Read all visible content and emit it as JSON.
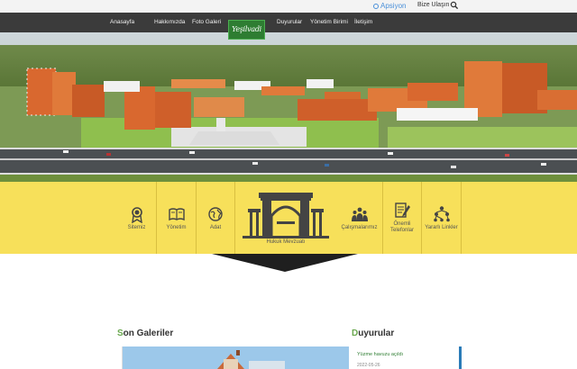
{
  "topbar": {
    "apsiyon_label": "Apsiyon",
    "contact_label": "Bize Ulaşın"
  },
  "nav": {
    "items": [
      "Anasayfa",
      "Hakkımızda",
      "Foto Galeri",
      "Duyurular",
      "Yönetim Birimi",
      "İletişim"
    ]
  },
  "logo": {
    "text": "Yeşilvadi"
  },
  "features": {
    "items": [
      {
        "label": "Sitemiz",
        "icon": "award-badge-icon"
      },
      {
        "label": "Yönetim",
        "icon": "book-icon"
      },
      {
        "label": "Adat",
        "icon": "globe-icon"
      },
      {
        "label": "Hukuk Mevzuatı",
        "icon": "arch-gate-icon"
      },
      {
        "label": "Çalışmalarımız",
        "icon": "team-icon"
      },
      {
        "label": "Önemli Telefonlar",
        "icon": "document-pen-icon"
      },
      {
        "label": "Yararlı Linkler",
        "icon": "network-icon"
      }
    ]
  },
  "sections": {
    "gallery_title_first": "S",
    "gallery_title_rest": "on Galeriler",
    "announcements_title_first": "D",
    "announcements_title_rest": "uyurular"
  },
  "announcement": {
    "title": "Yüzme havuzu açıldı",
    "date": "2022-05-26"
  },
  "colors": {
    "nav_bg": "#3b3b3b",
    "feature_bg": "#f7e05a",
    "accent_green": "#6aa84f",
    "accent_blue": "#2a7bb8"
  }
}
